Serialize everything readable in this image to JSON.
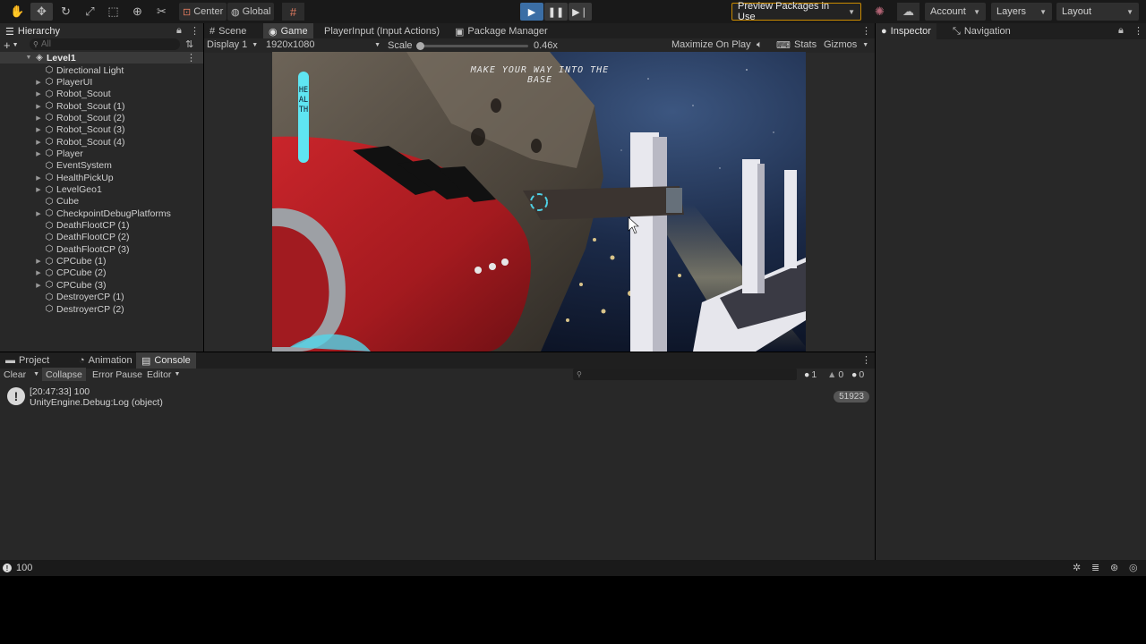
{
  "toolbar": {
    "tools": [
      {
        "name": "hand-tool",
        "glyph": "✋"
      },
      {
        "name": "move-tool",
        "glyph": "✥"
      },
      {
        "name": "rotate-tool",
        "glyph": "↻"
      },
      {
        "name": "scale-tool",
        "glyph": "⤢"
      },
      {
        "name": "rect-tool",
        "glyph": "⬚"
      },
      {
        "name": "transform-tool",
        "glyph": "⊕"
      },
      {
        "name": "custom-tool",
        "glyph": "✂"
      }
    ],
    "pivot_center": "Center",
    "pivot_global": "Global",
    "preview_packages": "Preview Packages in Use",
    "account": "Account",
    "layers": "Layers",
    "layout": "Layout"
  },
  "hierarchy": {
    "tab": "Hierarchy",
    "search_placeholder": "All",
    "scene": "Level1",
    "items": [
      {
        "label": "Directional Light",
        "expandable": false
      },
      {
        "label": "PlayerUI",
        "expandable": true
      },
      {
        "label": "Robot_Scout",
        "expandable": true
      },
      {
        "label": "Robot_Scout (1)",
        "expandable": true
      },
      {
        "label": "Robot_Scout (2)",
        "expandable": true
      },
      {
        "label": "Robot_Scout (3)",
        "expandable": true
      },
      {
        "label": "Robot_Scout (4)",
        "expandable": true
      },
      {
        "label": "Player",
        "expandable": true
      },
      {
        "label": "EventSystem",
        "expandable": false
      },
      {
        "label": "HealthPickUp",
        "expandable": true
      },
      {
        "label": "LevelGeo1",
        "expandable": true
      },
      {
        "label": "Cube",
        "expandable": false
      },
      {
        "label": "CheckpointDebugPlatforms",
        "expandable": true
      },
      {
        "label": "DeathFlootCP (1)",
        "expandable": false
      },
      {
        "label": "DeathFlootCP (2)",
        "expandable": false
      },
      {
        "label": "DeathFlootCP (3)",
        "expandable": false
      },
      {
        "label": "CPCube (1)",
        "expandable": true
      },
      {
        "label": "CPCube (2)",
        "expandable": true
      },
      {
        "label": "CPCube (3)",
        "expandable": true
      },
      {
        "label": "DestroyerCP (1)",
        "expandable": false
      },
      {
        "label": "DestroyerCP (2)",
        "expandable": false
      }
    ]
  },
  "center_tabs": {
    "scene": "Scene",
    "game": "Game",
    "player_input": "PlayerInput (Input Actions)",
    "package_manager": "Package Manager"
  },
  "game_bar": {
    "display": "Display 1",
    "resolution": "1920x1080",
    "scale_label": "Scale",
    "scale_value": "0.46x",
    "maximize": "Maximize On Play",
    "stats": "Stats",
    "gizmos": "Gizmos"
  },
  "game_view": {
    "objective": "MAKE YOUR WAY INTO THE BASE",
    "health_label": "HEALTH"
  },
  "right_tabs": {
    "inspector": "Inspector",
    "navigation": "Navigation"
  },
  "bottom_tabs": {
    "project": "Project",
    "animation": "Animation",
    "console": "Console"
  },
  "console": {
    "clear": "Clear",
    "collapse": "Collapse",
    "error_pause": "Error Pause",
    "editor": "Editor",
    "count_info": "1",
    "count_warn": "0",
    "count_err": "0",
    "entry_line1": "[20:47:33] 100",
    "entry_line2": "UnityEngine.Debug:Log (object)",
    "entry_count": "51923"
  },
  "status_bar": {
    "message": "100"
  },
  "colors": {
    "accent_play": "#3b6ea5",
    "preview_border": "#c98a00",
    "panel_bg": "#282828",
    "toolbar_bg": "#191919"
  }
}
